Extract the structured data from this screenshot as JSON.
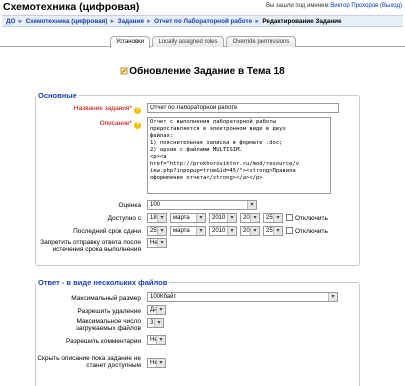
{
  "header": {
    "site_title": "Схемотехника (цифровая)",
    "login_prefix": "Вы зашли под именем",
    "user_name": "Виктор Прохоров",
    "logout_label": "(Выход)"
  },
  "breadcrumb": [
    {
      "label": "ДО"
    },
    {
      "label": "Схемотехника (цифровая)"
    },
    {
      "label": "Задания"
    },
    {
      "label": "Отчет по Лабораторной работе"
    },
    {
      "label": "Редактирование Задание"
    }
  ],
  "tabs": [
    {
      "label": "Установки"
    },
    {
      "label": "Locally assigned roles"
    },
    {
      "label": "Override permissions"
    }
  ],
  "page_title": "Обновление Задание в Тема 18",
  "section_basic": {
    "legend": "Основные",
    "name_label": "Название задания*",
    "name_value": "Отчет по Лабораторной работе",
    "desc_label": "Описание*",
    "desc_value": "Отчет с выполнения лабораторной работы\nпредоставляется в электронном виде в двух\nфайлах:\n1) пояснительная записка в формате .doc;\n2) архив с файлами MULTISIM.\n<p><a\nhref=\"http://prokhoroviktor.ru/mod/resource/v\niew.php?inpopup=true&id=45/\"><strong>Правила\nоформления отчета</strong></a></p>",
    "grade_label": "Оценка",
    "grade_value": "100",
    "available_label": "Доступно с",
    "available": {
      "day": "18",
      "month": "марта",
      "year": "2010",
      "hour": "20",
      "minute": "25"
    },
    "available_disable_label": "Отключить",
    "due_label": "Последний срок сдачи",
    "due": {
      "day": "25",
      "month": "марта",
      "year": "2010",
      "hour": "20",
      "minute": "25"
    },
    "due_disable_label": "Отключить",
    "prevent_late_label": "Запретить отправку ответа после истечения срока выполнения",
    "prevent_late_value": "Нет"
  },
  "section_files": {
    "legend": "Ответ - в виде нескольких файлов",
    "max_size_label": "Максимальный размер",
    "max_size_value": "100Кбайт",
    "allow_delete_label": "Разрешить удаление",
    "allow_delete_value": "Да",
    "max_files_label": "Максимальное число загружаемых файлов",
    "max_files_value": "3",
    "allow_notes_label": "Разрешить комментарии",
    "allow_notes_value": "Нет",
    "hide_desc_label": "Скрыть описание пока задание не станет доступным",
    "hide_desc_value": "Нет"
  },
  "colors": {
    "link": "#1a3fb3",
    "required": "#cc0000",
    "help": "#f0c000",
    "navbar_bg": "#e8eef6"
  }
}
